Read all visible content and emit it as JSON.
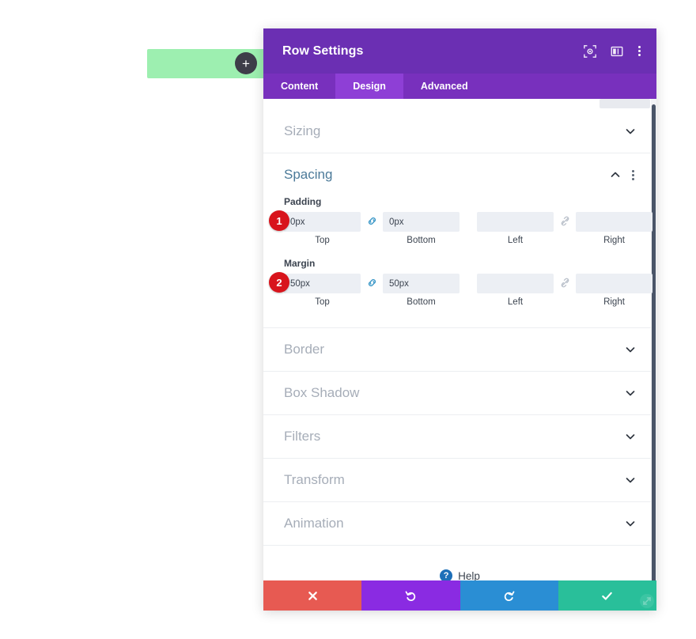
{
  "canvas": {
    "row_block": {
      "name": "row-block"
    },
    "add_button_label": "+"
  },
  "modal": {
    "title": "Row Settings",
    "header_icons": [
      {
        "name": "target-icon"
      },
      {
        "name": "layout-columns-icon"
      },
      {
        "name": "kebab-menu-icon"
      }
    ],
    "tabs": [
      {
        "label": "Content",
        "active": false
      },
      {
        "label": "Design",
        "active": true
      },
      {
        "label": "Advanced",
        "active": false
      }
    ],
    "sections": [
      {
        "label": "Sizing",
        "open": false
      },
      {
        "label": "Spacing",
        "open": true
      },
      {
        "label": "Border",
        "open": false
      },
      {
        "label": "Box Shadow",
        "open": false
      },
      {
        "label": "Filters",
        "open": false
      },
      {
        "label": "Transform",
        "open": false
      },
      {
        "label": "Animation",
        "open": false
      }
    ],
    "spacing": {
      "padding": {
        "group_label": "Padding",
        "badge": "1",
        "top": {
          "value": "0px",
          "sub": "Top"
        },
        "bottom": {
          "value": "0px",
          "sub": "Bottom"
        },
        "left": {
          "value": "",
          "placeholder": "",
          "sub": "Left"
        },
        "right": {
          "value": "",
          "placeholder": "",
          "sub": "Right"
        },
        "link_vertical": "linked",
        "link_horizontal": "unlinked"
      },
      "margin": {
        "group_label": "Margin",
        "badge": "2",
        "top": {
          "value": "50px",
          "sub": "Top"
        },
        "bottom": {
          "value": "50px",
          "sub": "Bottom"
        },
        "left": {
          "value": "",
          "placeholder": "",
          "sub": "Left"
        },
        "right": {
          "value": "",
          "placeholder": "",
          "sub": "Right"
        },
        "link_vertical": "linked",
        "link_horizontal": "unlinked"
      }
    },
    "help": {
      "label": "Help",
      "icon_glyph": "?"
    },
    "footer": [
      {
        "name": "cancel-button",
        "icon": "close-icon"
      },
      {
        "name": "undo-button",
        "icon": "undo-icon"
      },
      {
        "name": "redo-button",
        "icon": "redo-icon"
      },
      {
        "name": "save-button",
        "icon": "check-icon"
      }
    ]
  },
  "colors": {
    "header_purple": "#6b2fb3",
    "tabs_purple": "#7830bd",
    "tab_active": "#8e3fd6",
    "accent_blue": "#4c7a99",
    "badge_red": "#d8141c",
    "green_block": "#9defb0",
    "cancel": "#e75a52",
    "undo": "#8a2be2",
    "redo": "#2a8ed4",
    "save": "#29bf9a"
  }
}
